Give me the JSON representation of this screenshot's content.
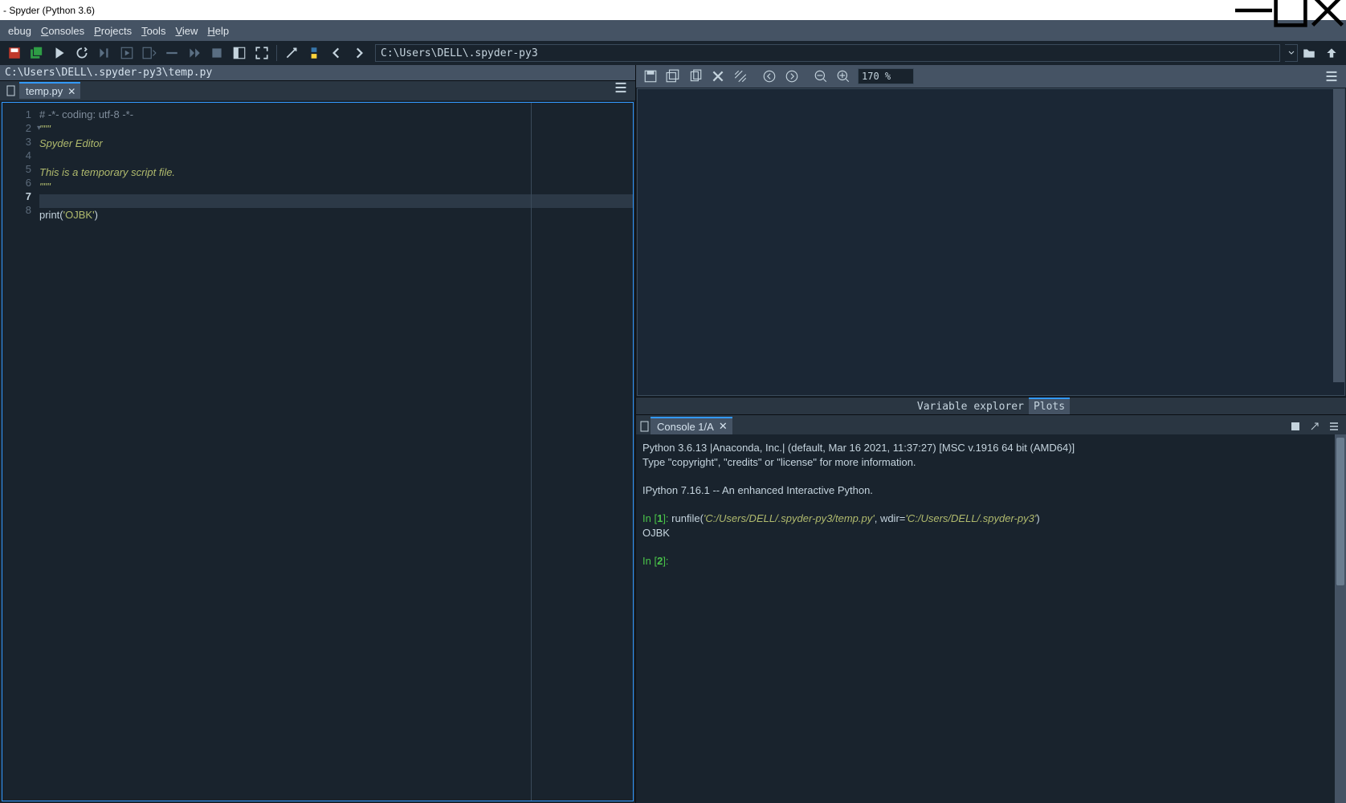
{
  "window": {
    "title": "- Spyder (Python 3.6)"
  },
  "menu": {
    "items": [
      "ebug",
      "Consoles",
      "Projects",
      "Tools",
      "View",
      "Help"
    ]
  },
  "cwd": {
    "path": "C:\\Users\\DELL\\.spyder-py3"
  },
  "editor": {
    "pathbar": "C:\\Users\\DELL\\.spyder-py3\\temp.py",
    "tab": {
      "label": "temp.py"
    },
    "lines": {
      "1": "# -*- coding: utf-8 -*-",
      "2": "\"\"\"",
      "3": "Spyder Editor",
      "4": "",
      "5": "This is a temporary script file.",
      "6": "\"\"\"",
      "7": "",
      "8a": "print",
      "8b": "(",
      "8c": "'OJBK'",
      "8d": ")"
    },
    "current_line": 7,
    "line_numbers": [
      "1",
      "2",
      "3",
      "4",
      "5",
      "6",
      "7",
      "8"
    ]
  },
  "image_pane": {
    "zoom": "170 %",
    "tabs": {
      "var": "Variable explorer",
      "plots": "Plots"
    }
  },
  "console": {
    "tab": "Console 1/A",
    "hdr1": "Python 3.6.13 |Anaconda, Inc.| (default, Mar 16 2021, 11:37:27) [MSC v.1916 64 bit (AMD64)]",
    "hdr2": "Type \"copyright\", \"credits\" or \"license\" for more information.",
    "hdr3": "IPython 7.16.1 -- An enhanced Interactive Python.",
    "in1": {
      "prefix": "In [",
      "n": "1",
      "suffix": "]: ",
      "cmd": "runfile(",
      "arg1": "'C:/Users/DELL/.spyder-py3/temp.py'",
      "mid": ", wdir=",
      "arg2": "'C:/Users/DELL/.spyder-py3'",
      "end": ")"
    },
    "out1": "OJBK",
    "in2": {
      "prefix": "In [",
      "n": "2",
      "suffix": "]: "
    }
  }
}
